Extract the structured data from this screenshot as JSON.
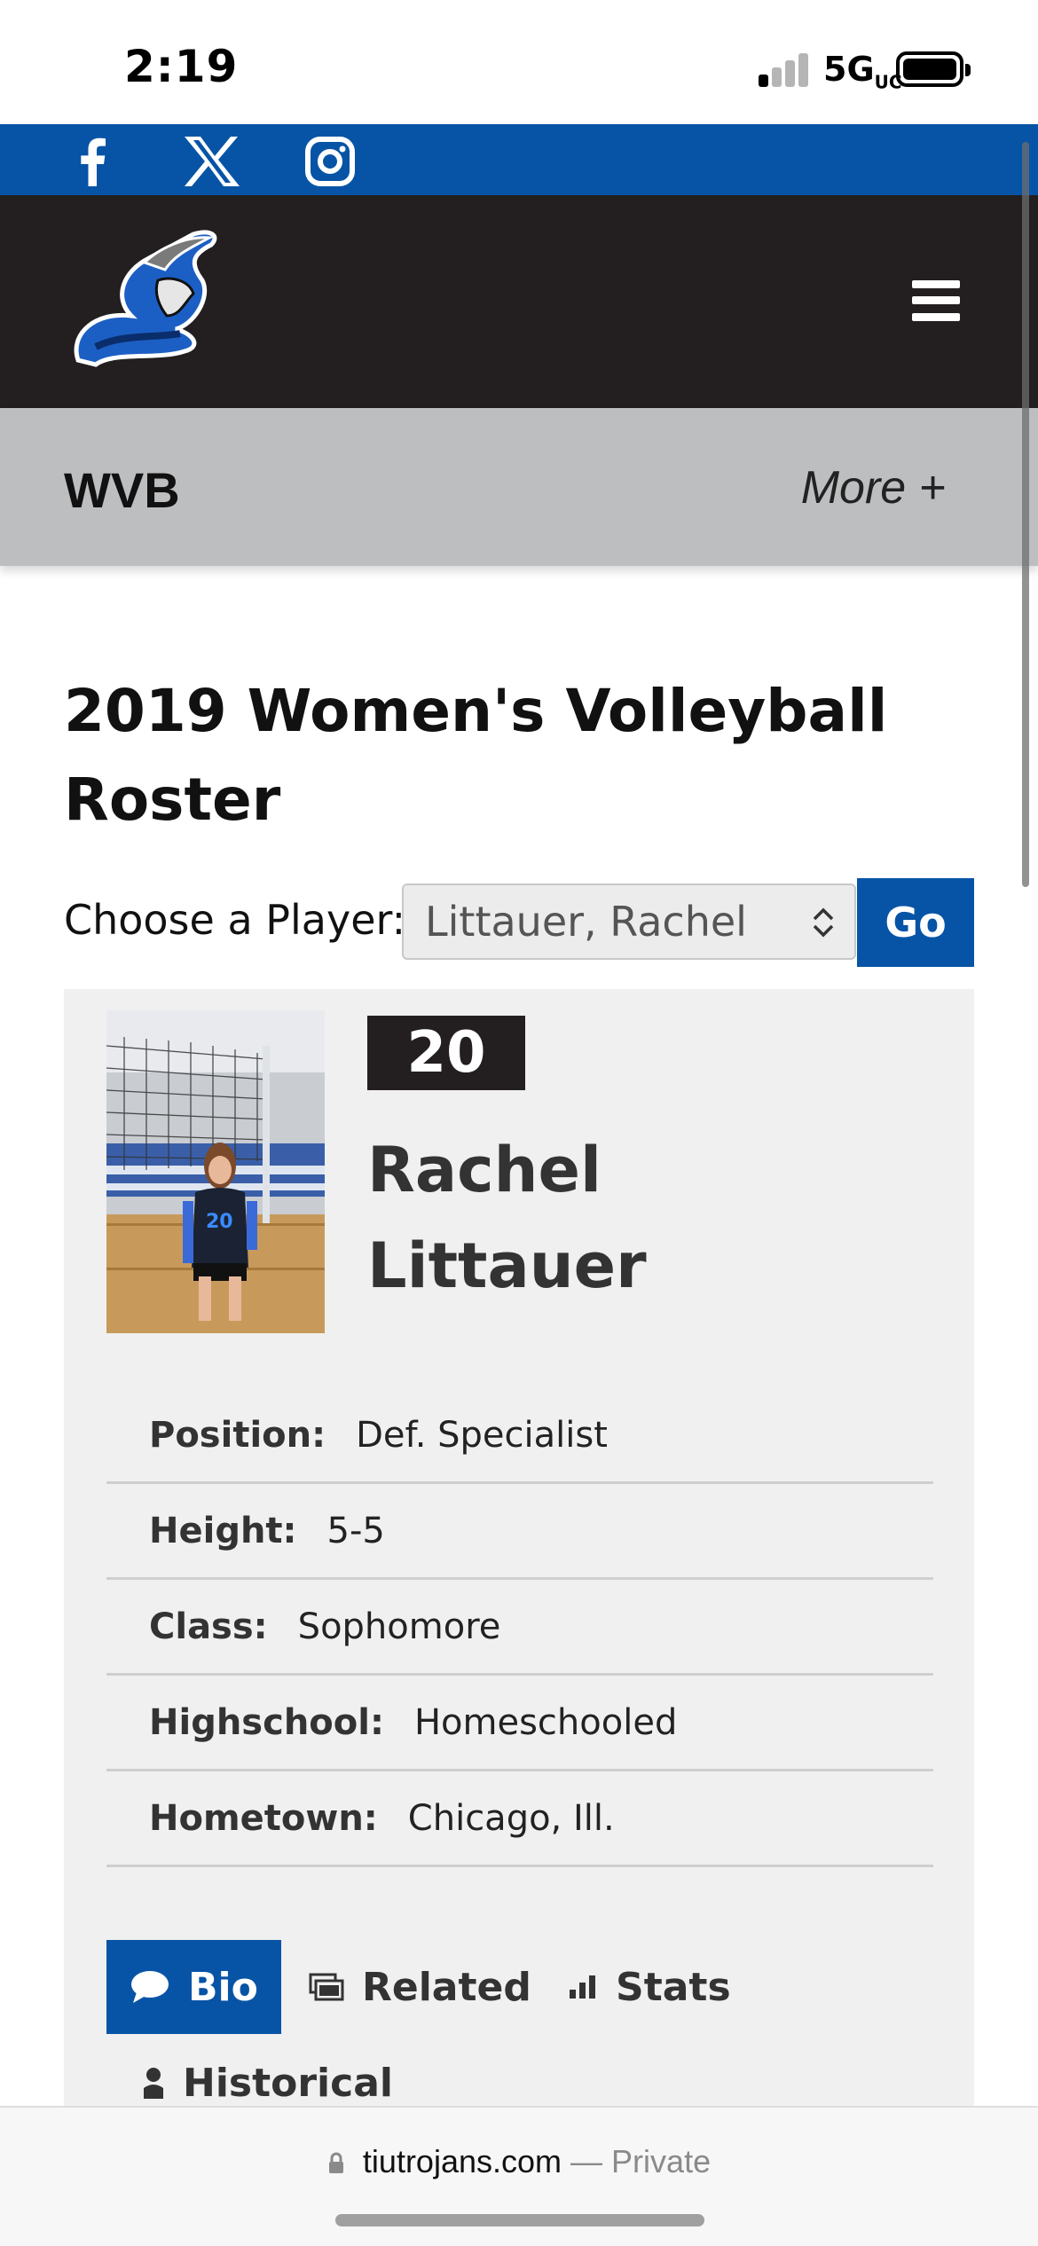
{
  "status_bar": {
    "time": "2:19",
    "network": "5G",
    "network_suffix": "UC"
  },
  "social": {
    "icons": [
      "facebook-icon",
      "x-icon",
      "instagram-icon"
    ],
    "bar_color": "#0754a6"
  },
  "header": {
    "logo": "trojan-logo",
    "menu_icon": "hamburger-menu-icon",
    "bg_color": "#231f20"
  },
  "subnav": {
    "title": "WVB",
    "more_label": "More +"
  },
  "page": {
    "title": "2019 Women's Volleyball Roster"
  },
  "chooser": {
    "label": "Choose a Player:",
    "selected": "Littauer, Rachel",
    "go_label": "Go"
  },
  "player": {
    "number": "20",
    "first_name": "Rachel",
    "last_name": "Littauer",
    "photo_jersey": "20",
    "info": [
      {
        "label": "Position:",
        "value": "Def. Specialist"
      },
      {
        "label": "Height:",
        "value": "5-5"
      },
      {
        "label": "Class:",
        "value": "Sophomore"
      },
      {
        "label": "Highschool:",
        "value": "Homeschooled"
      },
      {
        "label": "Hometown:",
        "value": "Chicago, Ill."
      }
    ]
  },
  "tabs": [
    {
      "label": "Bio",
      "icon": "comment-icon",
      "active": true
    },
    {
      "label": "Related",
      "icon": "images-icon",
      "active": false
    },
    {
      "label": "Stats",
      "icon": "bar-chart-icon",
      "active": false
    },
    {
      "label": "Historical",
      "icon": "user-icon",
      "active": false
    }
  ],
  "browser": {
    "domain": "tiutrojans.com",
    "separator": "—",
    "privacy": "Private"
  },
  "colors": {
    "accent": "#0754a6",
    "dark": "#231f20",
    "subnav": "#bdbec0",
    "card": "#f0f0f0"
  }
}
